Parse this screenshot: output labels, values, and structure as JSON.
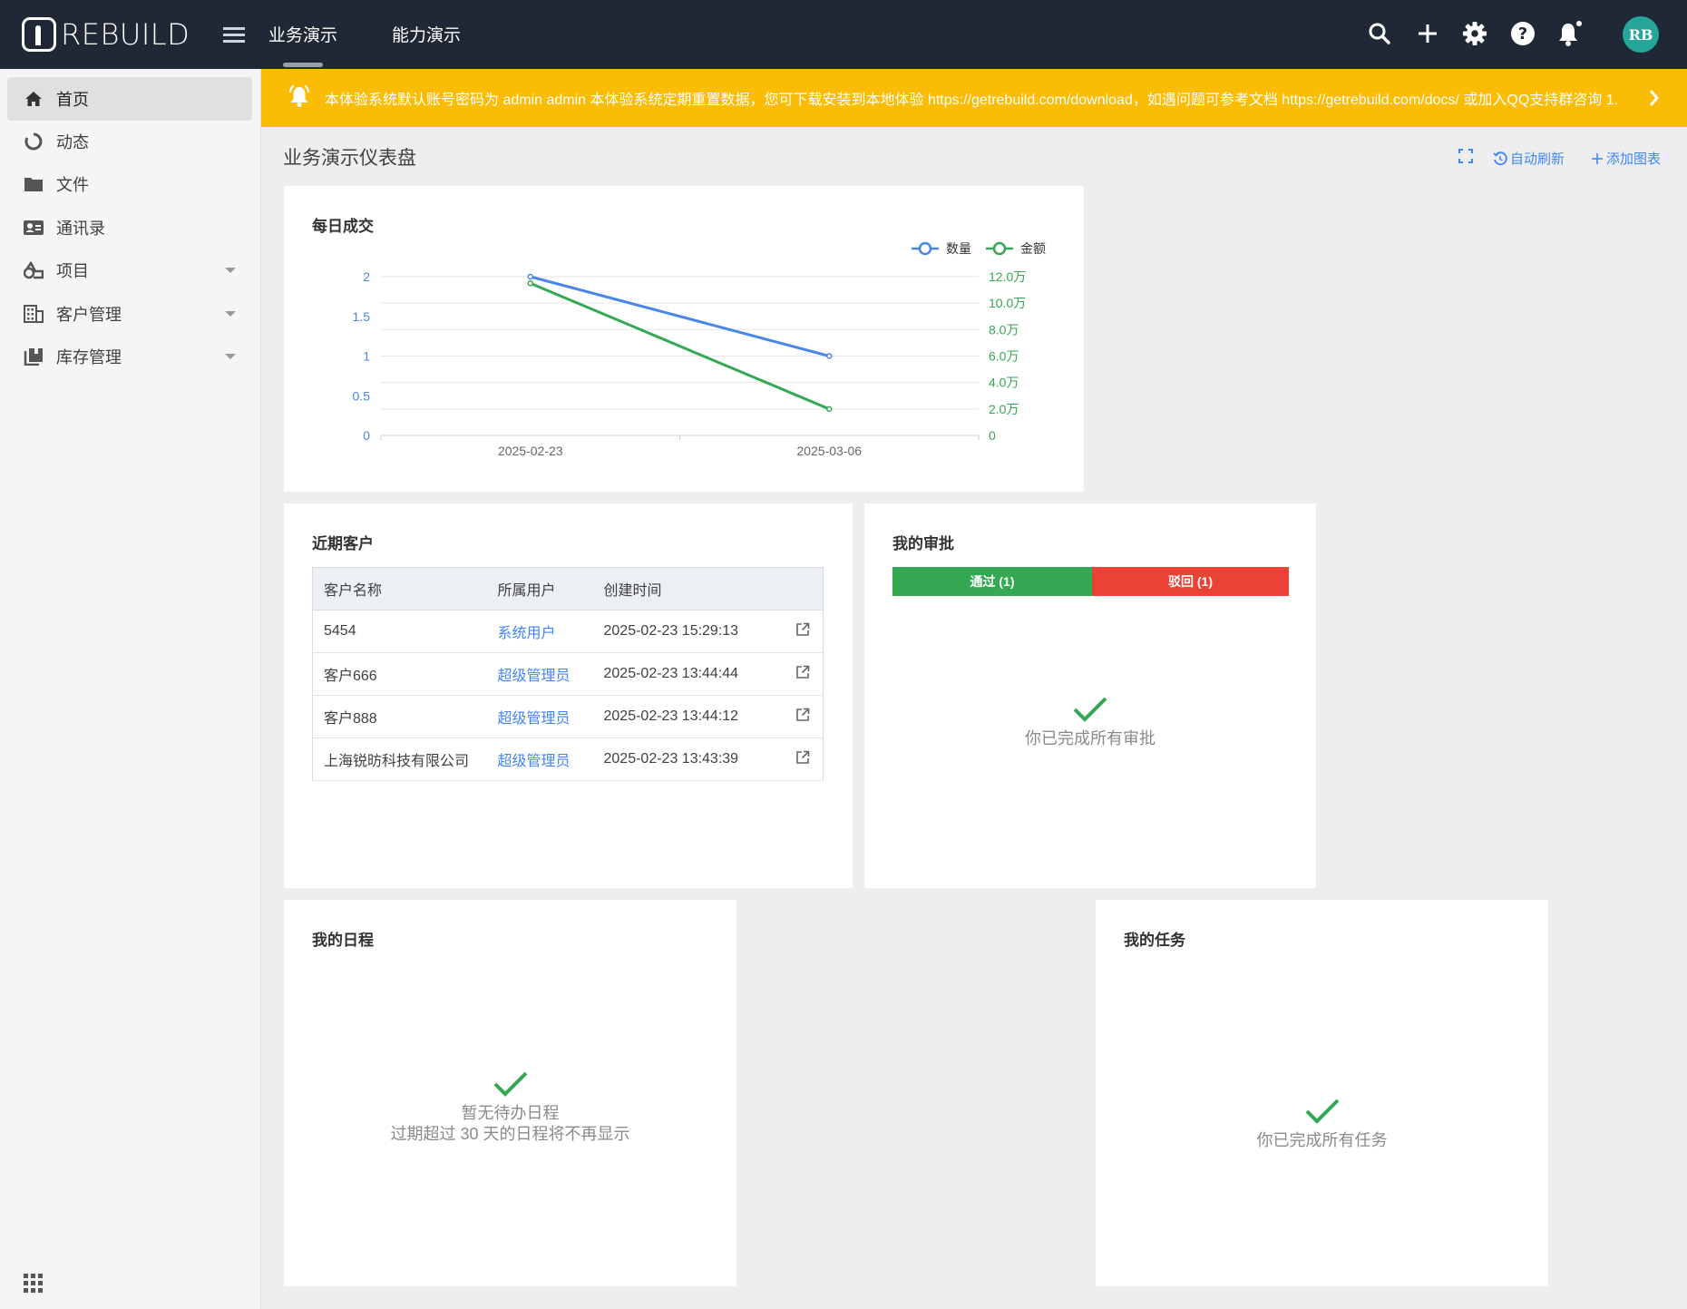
{
  "header": {
    "logo_text": "REBUILD",
    "nav_tabs": [
      {
        "label": "业务演示",
        "active": true
      },
      {
        "label": "能力演示",
        "active": false
      }
    ],
    "avatar_initials": "RB",
    "accent_color": "#212835"
  },
  "sidebar": {
    "items": [
      {
        "label": "首页",
        "icon": "home-icon",
        "active": true,
        "expandable": false
      },
      {
        "label": "动态",
        "icon": "activity-icon",
        "active": false,
        "expandable": false
      },
      {
        "label": "文件",
        "icon": "folder-icon",
        "active": false,
        "expandable": false
      },
      {
        "label": "通讯录",
        "icon": "contacts-icon",
        "active": false,
        "expandable": false
      },
      {
        "label": "项目",
        "icon": "project-icon",
        "active": false,
        "expandable": true
      },
      {
        "label": "客户管理",
        "icon": "building-icon",
        "active": false,
        "expandable": true
      },
      {
        "label": "库存管理",
        "icon": "inventory-icon",
        "active": false,
        "expandable": true
      }
    ]
  },
  "notice": {
    "text": "本体验系统默认账号密码为 admin admin 本体验系统定期重置数据，您可下载安装到本地体验 https://getrebuild.com/download，如遇问题可参考文档 https://getrebuild.com/docs/ 或加入QQ支持群咨询 1.",
    "color": "#fbbc05"
  },
  "dashboard": {
    "title": "业务演示仪表盘",
    "auto_refresh": "自动刷新",
    "add_chart": "添加图表"
  },
  "daily_deals": {
    "title": "每日成交"
  },
  "chart_data": {
    "type": "line",
    "title": "每日成交",
    "x": [
      "2025-02-23",
      "2025-03-06"
    ],
    "series": [
      {
        "name": "数量",
        "values": [
          2,
          1
        ],
        "color": "#4a86e8",
        "axis": "left"
      },
      {
        "name": "金额",
        "values": [
          115000,
          20000
        ],
        "color": "#34a853",
        "axis": "right"
      }
    ],
    "y_left": {
      "range": [
        0,
        2
      ],
      "ticks": [
        "0",
        "0.5",
        "1",
        "1.5",
        "2"
      ]
    },
    "y_right": {
      "range": [
        0,
        120000
      ],
      "ticks": [
        "0",
        "2.0万",
        "4.0万",
        "6.0万",
        "8.0万",
        "10.0万",
        "12.0万"
      ]
    },
    "legend": "top-right",
    "grid": true
  },
  "recent_customers": {
    "title": "近期客户",
    "columns": [
      "客户名称",
      "所属用户",
      "创建时间"
    ],
    "rows": [
      {
        "name": "5454",
        "user": "系统用户",
        "created": "2025-02-23 15:29:13"
      },
      {
        "name": "客户666",
        "user": "超级管理员",
        "created": "2025-02-23 13:44:44"
      },
      {
        "name": "客户888",
        "user": "超级管理员",
        "created": "2025-02-23 13:44:12"
      },
      {
        "name": "上海锐昉科技有限公司",
        "user": "超级管理员",
        "created": "2025-02-23 13:43:39"
      }
    ]
  },
  "approvals": {
    "title": "我的审批",
    "passed_label": "通过 (1)",
    "rejected_label": "驳回 (1)",
    "passed_color": "#34a853",
    "rejected_color": "#ea4335",
    "empty_text": "你已完成所有审批"
  },
  "schedule": {
    "title": "我的日程",
    "empty_line1": "暂无待办日程",
    "empty_line2": "过期超过 30 天的日程将不再显示"
  },
  "tasks": {
    "title": "我的任务",
    "empty_text": "你已完成所有任务"
  }
}
